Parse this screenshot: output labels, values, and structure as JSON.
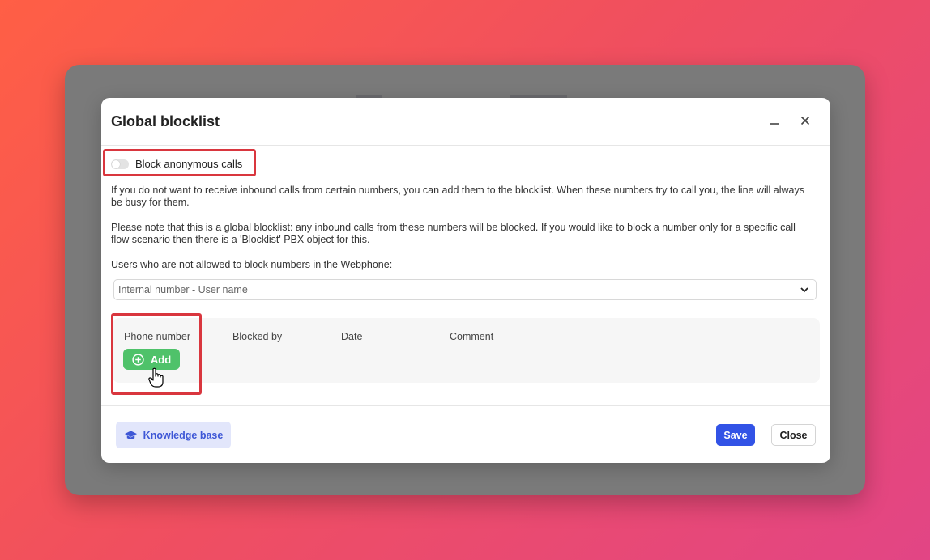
{
  "dialog": {
    "title": "Global blocklist"
  },
  "toggle": {
    "label": "Block anonymous calls",
    "checked": false
  },
  "description": {
    "paragraph1": "If you do not want to receive inbound calls from certain numbers, you can add them to the blocklist. When these numbers try to call you, the line will always be busy for them.",
    "paragraph2": "Please note that this is a global blocklist: any inbound calls from these numbers will be blocked. If you would like to block a number only for a specific call flow scenario then there is a 'Blocklist' PBX object for this.",
    "users_label": "Users who are not allowed to block numbers in the Webphone:"
  },
  "select": {
    "placeholder": "Internal number - User name"
  },
  "table": {
    "columns": [
      "Phone number",
      "Blocked by",
      "Date",
      "Comment"
    ],
    "add_label": "Add"
  },
  "footer": {
    "knowledge_base_label": "Knowledge base",
    "save_label": "Save",
    "close_label": "Close"
  },
  "colors": {
    "highlight": "#d9363e",
    "add_button": "#4fc26a",
    "save_button": "#3253e6",
    "knowledge_base_bg": "#e2e6fb"
  },
  "icons": [
    "minimize-icon",
    "close-icon",
    "chevron-down-icon",
    "plus-circle-icon",
    "graduation-cap-icon",
    "hand-pointer-icon"
  ]
}
